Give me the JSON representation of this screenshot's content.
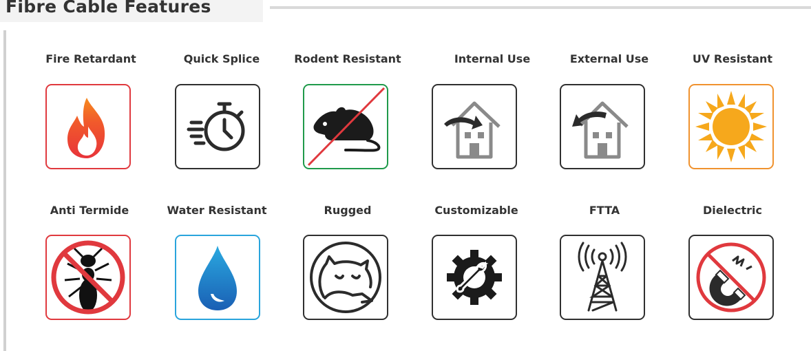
{
  "section": {
    "title": "Fibre Cable Features"
  },
  "features": [
    {
      "label": "Fire Retardant",
      "icon": "flame-icon",
      "border_color": "#e0393e"
    },
    {
      "label": "Quick Splice",
      "icon": "stopwatch-icon",
      "border_color": "#2f2f2f"
    },
    {
      "label": "Rodent Resistant",
      "icon": "no-rat-icon",
      "border_color": "#1f9a4a"
    },
    {
      "label": "Internal Use",
      "icon": "house-arrow-in-icon",
      "border_color": "#2f2f2f"
    },
    {
      "label": "External Use",
      "icon": "house-arrow-out-icon",
      "border_color": "#2f2f2f"
    },
    {
      "label": "UV Resistant",
      "icon": "sun-icon",
      "border_color": "#f0922e"
    },
    {
      "label": "Anti Termide",
      "icon": "no-termite-icon",
      "border_color": "#e0393e"
    },
    {
      "label": "Water Resistant",
      "icon": "water-drop-icon",
      "border_color": "#29a4dc"
    },
    {
      "label": "Rugged",
      "icon": "rhino-icon",
      "border_color": "#2f2f2f"
    },
    {
      "label": "Customizable",
      "icon": "gear-wrench-icon",
      "border_color": "#2f2f2f"
    },
    {
      "label": "FTTA",
      "icon": "antenna-tower-icon",
      "border_color": "#2f2f2f"
    },
    {
      "label": "Dielectric",
      "icon": "no-magnet-icon",
      "border_color": "#2f2f2f"
    }
  ]
}
